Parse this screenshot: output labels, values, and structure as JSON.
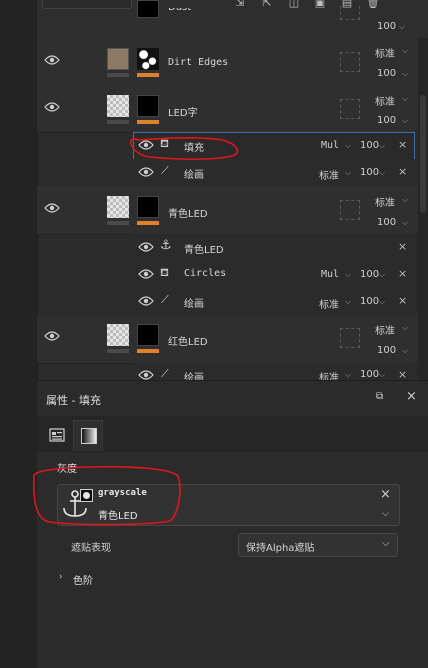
{
  "toolbar": {
    "icons": [
      "layer-add-icon",
      "group-icon",
      "mask-icon",
      "folder-icon",
      "copy-icon",
      "delete-icon"
    ]
  },
  "layers": [
    {
      "name": "Dust",
      "opacity": "100"
    },
    {
      "name": "Dirt Edges",
      "blend": "标准",
      "opacity": "100"
    },
    {
      "name": "LED字",
      "blend": "标准",
      "opacity": "100"
    },
    {
      "name": "青色LED",
      "blend": "标准",
      "opacity": "100"
    },
    {
      "name": "红色LED",
      "blend": "标准",
      "opacity": "100"
    }
  ],
  "effects": {
    "led_fill": {
      "name": "填充",
      "blend": "Mul",
      "opacity": "100"
    },
    "led_paint": {
      "name": "绘画",
      "blend": "标准",
      "opacity": "100"
    },
    "cyan_anchor": {
      "name": "青色LED"
    },
    "cyan_circles": {
      "name": "Circles",
      "blend": "Mul",
      "opacity": "100"
    },
    "cyan_paint": {
      "name": "绘画",
      "blend": "标准",
      "opacity": "100"
    },
    "red_paint": {
      "name": "绘画",
      "blend": "标准",
      "opacity": "100"
    }
  },
  "properties": {
    "title": "属性 - 填充",
    "section": "灰度",
    "card_title": "grayscale",
    "card_source": "青色LED",
    "mapping_label": "遮贴表现",
    "mapping_value": "保持Alpha遮贴",
    "levels_label": "色阶"
  },
  "colors": {
    "accent_orange": "#e0802a",
    "selection_blue": "#3e6fa8",
    "annotation_red": "#e0161b"
  }
}
